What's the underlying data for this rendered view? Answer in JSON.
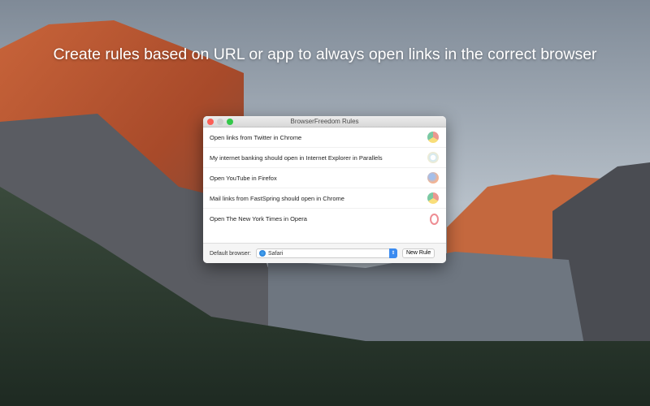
{
  "headline": "Create rules based on URL or app to always open links in the correct browser",
  "window": {
    "title": "BrowserFreedom Rules",
    "rules": [
      {
        "label": "Open links from Twitter in Chrome",
        "icon": "chrome-icon"
      },
      {
        "label": "My internet banking should open in Internet Explorer in Parallels",
        "icon": "internet-explorer-icon"
      },
      {
        "label": "Open YouTube in Firefox",
        "icon": "firefox-icon"
      },
      {
        "label": "Mail links from FastSpring should open in Chrome",
        "icon": "chrome-icon"
      },
      {
        "label": "Open The New York Times in Opera",
        "icon": "opera-icon"
      }
    ],
    "footer": {
      "default_label": "Default browser:",
      "selected": "Safari",
      "new_rule": "New Rule"
    }
  },
  "colors": {
    "close": "#fc5f57",
    "minimize": "#cfcfcf",
    "zoom": "#34c84a",
    "accent": "#3b8bf0"
  }
}
